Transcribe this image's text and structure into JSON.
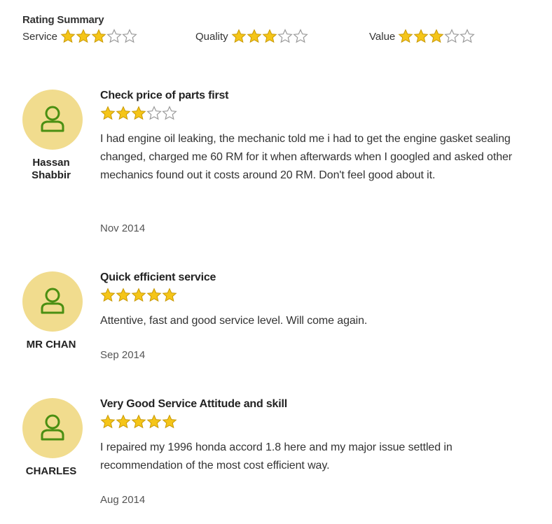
{
  "summary": {
    "title": "Rating Summary",
    "categories": [
      {
        "label": "Service",
        "rating": 3,
        "max": 5
      },
      {
        "label": "Quality",
        "rating": 3,
        "max": 5
      },
      {
        "label": "Value",
        "rating": 3,
        "max": 5
      }
    ]
  },
  "star_colors": {
    "filled": "#f5c518",
    "empty": "#ffffff",
    "empty_outline": "#9a9a9a"
  },
  "avatar_color": "#f1dc8e",
  "avatar_icon_color": "#4a8f12",
  "reviews": [
    {
      "name": "Hassan Shabbir",
      "title": "Check price of parts first",
      "rating": 3,
      "max": 5,
      "text": "I had engine oil leaking, the mechanic told me i had to get the engine gasket sealing changed, charged me 60 RM for it when afterwards when I googled and asked other mechanics found out it costs around 20 RM. Don't feel good about it.",
      "date": "Nov 2014"
    },
    {
      "name": "MR CHAN",
      "title": "Quick efficient service",
      "rating": 5,
      "max": 5,
      "text": "Attentive, fast and good service level. Will come again.",
      "date": "Sep 2014"
    },
    {
      "name": "CHARLES",
      "title": "Very Good Service Attitude and skill",
      "rating": 5,
      "max": 5,
      "text": "I repaired my 1996 honda accord 1.8 here and my major issue settled in recommendation of the most cost efficient way.",
      "date": "Aug 2014"
    }
  ]
}
